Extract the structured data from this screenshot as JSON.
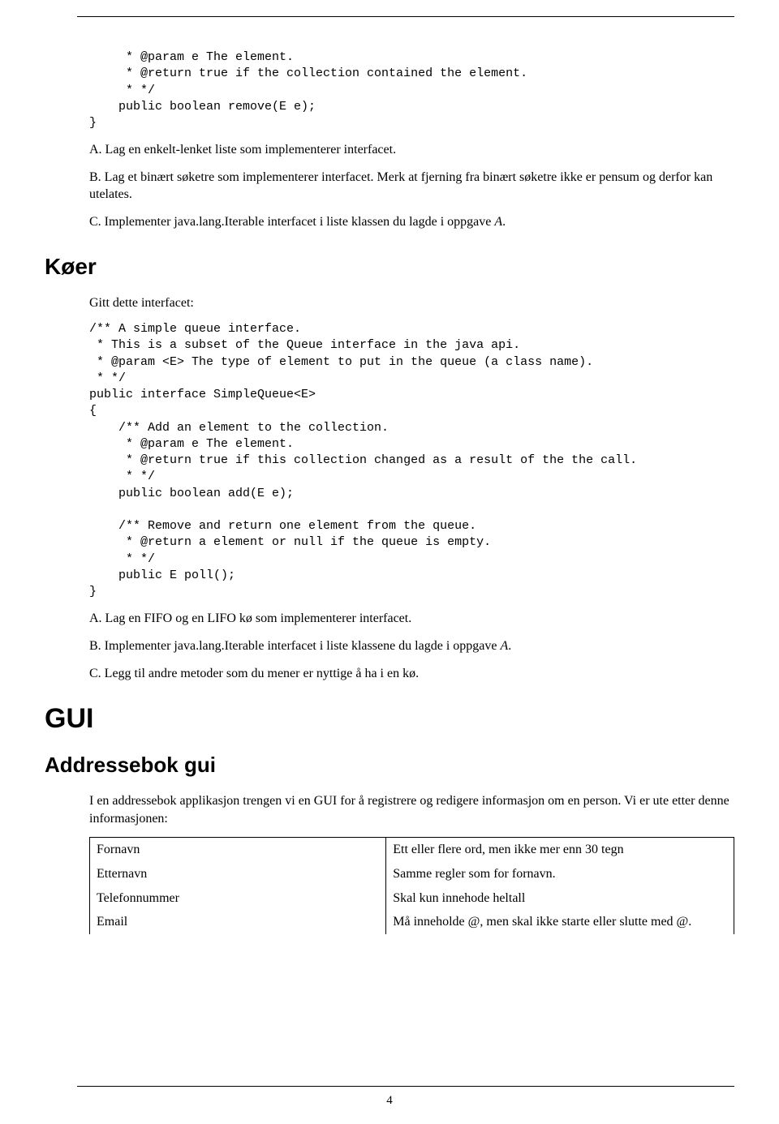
{
  "code1": {
    "l1": "     * @param e The element.",
    "l2": "     * @return true if the collection contained the element.",
    "l3": "     * */",
    "l4": "    public boolean remove(E e);",
    "l5": "}"
  },
  "tasksA": {
    "a": "A. Lag en enkelt-lenket liste som implementerer interfacet.",
    "b": "B. Lag et binært søketre som implementerer interfacet. Merk at fjerning fra binært søketre ikke er pensum og derfor kan utelates.",
    "c_prefix": "C. Implementer java.lang.Iterable interfacet i liste klassen du lagde i oppgave ",
    "c_em": "A",
    "c_suffix": "."
  },
  "koer": {
    "title": "Køer",
    "intro": "Gitt dette interfacet:"
  },
  "code2": {
    "l1": "/** A simple queue interface.",
    "l2": " * This is a subset of the Queue interface in the java api.",
    "l3": " * @param <E> The type of element to put in the queue (a class name).",
    "l4": " * */",
    "l5": "public interface SimpleQueue<E>",
    "l6": "{",
    "l7": "    /** Add an element to the collection.",
    "l8": "     * @param e The element.",
    "l9": "     * @return true if this collection changed as a result of the the call.",
    "l10": "     * */",
    "l11": "    public boolean add(E e);",
    "blank": "",
    "l12": "    /** Remove and return one element from the queue.",
    "l13": "     * @return a element or null if the queue is empty.",
    "l14": "     * */",
    "l15": "    public E poll();",
    "l16": "}"
  },
  "tasksB": {
    "a": "A. Lag en FIFO og en LIFO kø som implementerer interfacet.",
    "b_prefix": "B. Implementer java.lang.Iterable interfacet i liste klassene du lagde i oppgave ",
    "b_em": "A",
    "b_suffix": ".",
    "c": "C. Legg til andre metoder som du mener er nyttige å ha i en kø."
  },
  "gui": {
    "title": "GUI",
    "subtitle": "Addressebok gui",
    "intro": "I en addressebok applikasjon trengen vi en GUI for å registrere og redigere informasjon om en person. Vi er ute etter denne informasjonen:"
  },
  "table": {
    "rows": [
      {
        "field": "Fornavn",
        "desc": "Ett eller flere ord, men ikke mer enn 30 tegn"
      },
      {
        "field": "Etternavn",
        "desc": "Samme regler som for fornavn."
      },
      {
        "field": "Telefonnummer",
        "desc": "Skal kun innehode heltall"
      },
      {
        "field": "Email",
        "desc": "Må inneholde @, men skal ikke starte eller slutte med @."
      }
    ]
  },
  "pageNumber": "4"
}
